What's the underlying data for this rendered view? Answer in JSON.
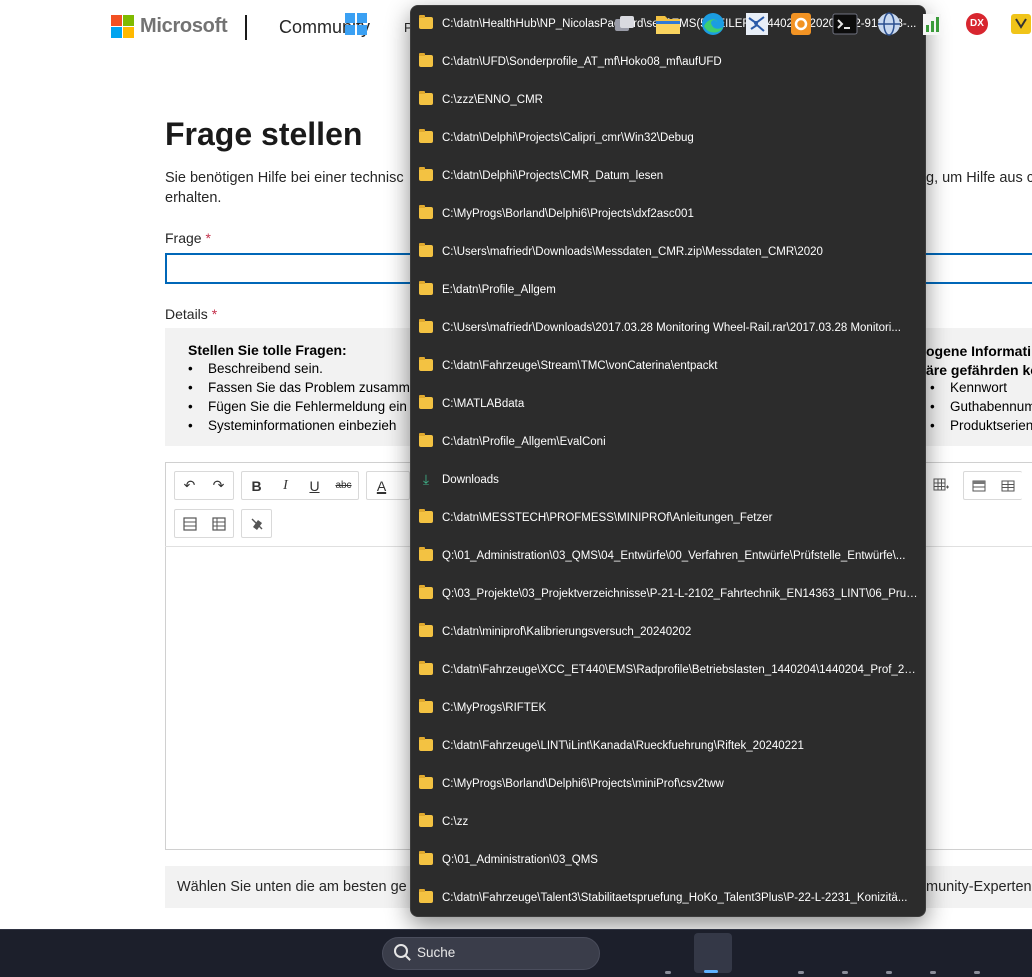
{
  "header": {
    "brand": "Microsoft",
    "section": "Community",
    "more": "P",
    "logo_colors": [
      "#f25022",
      "#7fba00",
      "#00a4ef",
      "#ffb900"
    ]
  },
  "page": {
    "title": "Frage stellen",
    "intro_left": "Sie benötigen Hilfe bei einer technisc",
    "intro_right": "g, um Hilfe aus c",
    "intro_line2": "erhalten.",
    "question_label": "Frage",
    "details_label": "Details",
    "required_mark": "*",
    "tips": {
      "title": "Stellen Sie tolle Fragen:",
      "items": [
        "Beschreibend sein.",
        "Fassen Sie das Problem zusamme",
        "Fügen Sie die Fehlermeldung ein",
        "Systeminformationen einbezieh"
      ]
    },
    "warning": {
      "title_line1": "ogene Informati",
      "title_line2": "äre gefährden kö",
      "items": [
        "Kennwort",
        "Guthabennum",
        "Produktserien"
      ]
    },
    "bottom_left": "Wählen Sie unten die am besten ge",
    "bottom_right": "munity-Experten"
  },
  "toolbar": {
    "undo": "↶",
    "redo": "↷",
    "bold": "B",
    "italic": "I",
    "underline": "U",
    "strike": "abc",
    "font_color": "A"
  },
  "jumplist": {
    "items": [
      {
        "icon": "folder-icon",
        "label": "C:\\datn\\HealthHub\\NP_NicolasPagnard\\sent\\EMS(5-TEILER)_1440205-20200212-913088-..."
      },
      {
        "icon": "folder-icon",
        "label": "C:\\datn\\UFD\\Sonderprofile_AT_mf\\Hoko08_mf\\aufUFD"
      },
      {
        "icon": "folder-icon",
        "label": "C:\\zzz\\ENNO_CMR"
      },
      {
        "icon": "folder-icon",
        "label": "C:\\datn\\Delphi\\Projects\\Calipri_cmr\\Win32\\Debug"
      },
      {
        "icon": "folder-icon",
        "label": "C:\\datn\\Delphi\\Projects\\CMR_Datum_lesen"
      },
      {
        "icon": "folder-icon",
        "label": "C:\\MyProgs\\Borland\\Delphi6\\Projects\\dxf2asc001"
      },
      {
        "icon": "folder-icon",
        "label": "C:\\Users\\mafriedr\\Downloads\\Messdaten_CMR.zip\\Messdaten_CMR\\2020"
      },
      {
        "icon": "folder-icon",
        "label": "E:\\datn\\Profile_Allgem"
      },
      {
        "icon": "folder-icon",
        "label": "C:\\Users\\mafriedr\\Downloads\\2017.03.28 Monitoring Wheel-Rail.rar\\2017.03.28 Monitori..."
      },
      {
        "icon": "folder-icon",
        "label": "C:\\datn\\Fahrzeuge\\Stream\\TMC\\vonCaterina\\entpackt"
      },
      {
        "icon": "folder-icon",
        "label": "C:\\MATLABdata"
      },
      {
        "icon": "folder-icon",
        "label": "C:\\datn\\Profile_Allgem\\EvalConi"
      },
      {
        "icon": "download-icon",
        "label": "Downloads"
      },
      {
        "icon": "folder-icon",
        "label": "C:\\datn\\MESSTECH\\PROFMESS\\MINIPROf\\Anleitungen_Fetzer"
      },
      {
        "icon": "folder-icon",
        "label": "Q:\\01_Administration\\03_QMS\\04_Entwürfe\\00_Verfahren_Entwürfe\\Prüfstelle_Entwürfe\\..."
      },
      {
        "icon": "folder-icon",
        "label": "Q:\\03_Projekte\\03_Projektverzeichnisse\\P-21-L-2102_Fahrtechnik_EN14363_LINT\\06_Prue..."
      },
      {
        "icon": "folder-icon",
        "label": "C:\\datn\\miniprof\\Kalibrierungsversuch_20240202"
      },
      {
        "icon": "folder-icon",
        "label": "C:\\datn\\Fahrzeuge\\XCC_ET440\\EMS\\Radprofile\\Betriebslasten_1440204\\1440204_Prof_20..."
      },
      {
        "icon": "folder-icon",
        "label": "C:\\MyProgs\\RIFTEK"
      },
      {
        "icon": "folder-icon",
        "label": "C:\\datn\\Fahrzeuge\\LINT\\iLint\\Kanada\\Rueckfuehrung\\Riftek_20240221"
      },
      {
        "icon": "folder-icon",
        "label": "C:\\MyProgs\\Borland\\Delphi6\\Projects\\miniProf\\csv2tww"
      },
      {
        "icon": "folder-icon",
        "label": "C:\\zz"
      },
      {
        "icon": "folder-icon",
        "label": "Q:\\01_Administration\\03_QMS"
      },
      {
        "icon": "folder-icon",
        "label": "C:\\datn\\Fahrzeuge\\Talent3\\Stabilitaetspruefung_HoKo_Talent3Plus\\P-22-L-2231_Konizitä..."
      }
    ]
  },
  "taskbar": {
    "search_placeholder": "Suche",
    "apps": [
      "start-icon",
      "task-view-icon",
      "file-explorer-icon",
      "edge-icon",
      "network-app-icon",
      "office-app-icon",
      "terminal-icon",
      "globe-app-icon",
      "chart-app-icon",
      "dx-app-icon",
      "notes-app-icon"
    ],
    "dx_label": "DX"
  }
}
